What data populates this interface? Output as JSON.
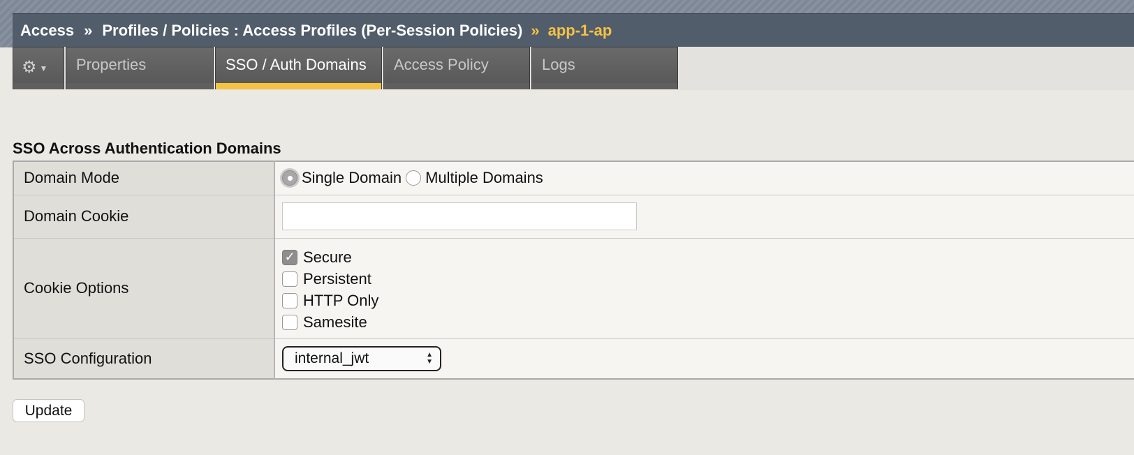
{
  "breadcrumb": {
    "root": "Access",
    "sep1": "»",
    "middle": "Profiles / Policies : Access Profiles (Per-Session Policies)",
    "sep2": "»",
    "current": "app-1-ap"
  },
  "tabs": [
    {
      "label": "Properties",
      "active": false
    },
    {
      "label": "SSO / Auth Domains",
      "active": true
    },
    {
      "label": "Access Policy",
      "active": false
    },
    {
      "label": "Logs",
      "active": false
    }
  ],
  "gear_menu": {
    "icon": "gear-icon",
    "caret": "chevron-down-icon"
  },
  "section": {
    "title": "SSO Across Authentication Domains"
  },
  "form": {
    "domain_mode": {
      "label": "Domain Mode",
      "options": [
        {
          "label": "Single Domain",
          "selected": true
        },
        {
          "label": "Multiple Domains",
          "selected": false
        }
      ]
    },
    "domain_cookie": {
      "label": "Domain Cookie",
      "value": ""
    },
    "cookie_options": {
      "label": "Cookie Options",
      "options": [
        {
          "label": "Secure",
          "checked": true
        },
        {
          "label": "Persistent",
          "checked": false
        },
        {
          "label": "HTTP Only",
          "checked": false
        },
        {
          "label": "Samesite",
          "checked": false
        }
      ]
    },
    "sso_configuration": {
      "label": "SSO Configuration",
      "value": "internal_jwt"
    }
  },
  "actions": {
    "update_label": "Update"
  },
  "colors": {
    "accent": "#f5c242",
    "header_bg": "#525d6b"
  }
}
